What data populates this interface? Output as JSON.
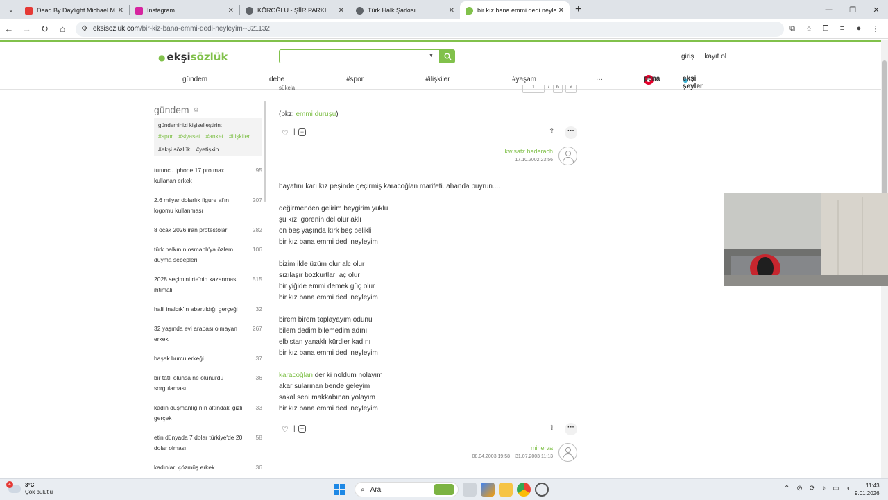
{
  "browser": {
    "tabs": [
      {
        "title": "Dead By Daylight Michael Myers",
        "fav_color": "#e53935"
      },
      {
        "title": "Instagram",
        "fav_color": "#d6249f"
      },
      {
        "title": "KÖROĞLU - ŞİİR PARKI",
        "fav_color": "#5f6368"
      },
      {
        "title": "Türk Halk Şarkısı",
        "fav_color": "#5f6368"
      },
      {
        "title": "bir kız bana emmi dedi neyleye",
        "fav_color": "#81c14b"
      }
    ],
    "url_host": "eksisozluk.com",
    "url_path": "/bir-kiz-bana-emmi-dedi-neyleyim--321132"
  },
  "site": {
    "logo_pre": "ekşi",
    "logo_post": "sözlük",
    "login": "giriş",
    "register": "kayıt ol",
    "nav": [
      "gündem",
      "debe",
      "#spor",
      "#ilişkiler",
      "#yaşam",
      "···"
    ],
    "pena": "pena",
    "eksi_seyler": "ekşi şeyler"
  },
  "sidebar": {
    "heading": "gündem",
    "personalize_text": "gündeminizi kişiselleştirin:",
    "tags_green": [
      "#spor",
      "#siyaset",
      "#anket",
      "#ilişkiler"
    ],
    "tags_grey": [
      "#ekşi sözlük",
      "#yetişkin"
    ],
    "topics": [
      {
        "title": "turuncu iphone 17 pro max kullanan erkek",
        "count": "95"
      },
      {
        "title": "2.6 milyar dolarlık figure ai'ın logomu kullanması",
        "count": "207"
      },
      {
        "title": "8 ocak 2026 iran protestoları",
        "count": "282"
      },
      {
        "title": "türk halkının osmanlı'ya özlem duyma sebepleri",
        "count": "106"
      },
      {
        "title": "2028 seçimini rte'nin kazanması ihtimali",
        "count": "515"
      },
      {
        "title": "halil inalcık'ın abartıldığı gerçeği",
        "count": "32"
      },
      {
        "title": "32 yaşında evi arabası olmayan erkek",
        "count": "267"
      },
      {
        "title": "başak burcu erkeği",
        "count": "37"
      },
      {
        "title": "bir tatlı olunsa ne olunurdu sorgulaması",
        "count": "36"
      },
      {
        "title": "kadın düşmanlığının altındaki gizli gerçek",
        "count": "33"
      },
      {
        "title": "etin dünyada 7 dolar türkiye'de 20 dolar olması",
        "count": "58"
      },
      {
        "title": "kadınları çözmüş erkek",
        "count": "36"
      }
    ]
  },
  "content": {
    "top_cut_text": "şükela",
    "pager_current": "1",
    "pager_total": "6",
    "entry1": {
      "bkz_pre": "(bkz: ",
      "bkz_link": "emmi duruşu",
      "bkz_post": ")",
      "author": "kwisatz haderach",
      "date": "17.10.2002 23:56"
    },
    "entry2": {
      "intro": "hayatını karı kız peşinde geçirmiş karacoğlan marifeti. ahanda buyrun....",
      "stanza1": [
        "değirmenden gelirim beygirim yüklü",
        "şu kızı görenin del olur aklı",
        "on beş yaşında kırk beş belikli",
        "bir kız bana emmi dedi neyleyim"
      ],
      "stanza2": [
        "bizim ilde üzüm olur alc olur",
        "sızılaşır bozkurtları aç olur",
        "bir yiğide emmi demek güç olur",
        "bir kız bana emmi dedi neyleyim"
      ],
      "stanza3": [
        "birem birem toplayayım odunu",
        "bilem dedim bilemedim adını",
        "elbistan yanaklı kürdler kadını",
        "bir kız bana emmi dedi neyleyim"
      ],
      "stanza4_link": "karacoğlan",
      "stanza4_first_rest": " der ki noldum nolayım",
      "stanza4": [
        "akar sularınan bende geleyim",
        "sakal seni makkabınan yolayım",
        "bir kız bana emmi dedi neyleyim"
      ],
      "author": "minerva",
      "date": "08.04.2003 19:58 ~ 31.07.2003 11:13"
    }
  },
  "taskbar": {
    "badge": "4",
    "temp": "3°C",
    "weather": "Çok bulutlu",
    "search": "Ara",
    "time": "11:43",
    "date": "9.01.2026"
  }
}
